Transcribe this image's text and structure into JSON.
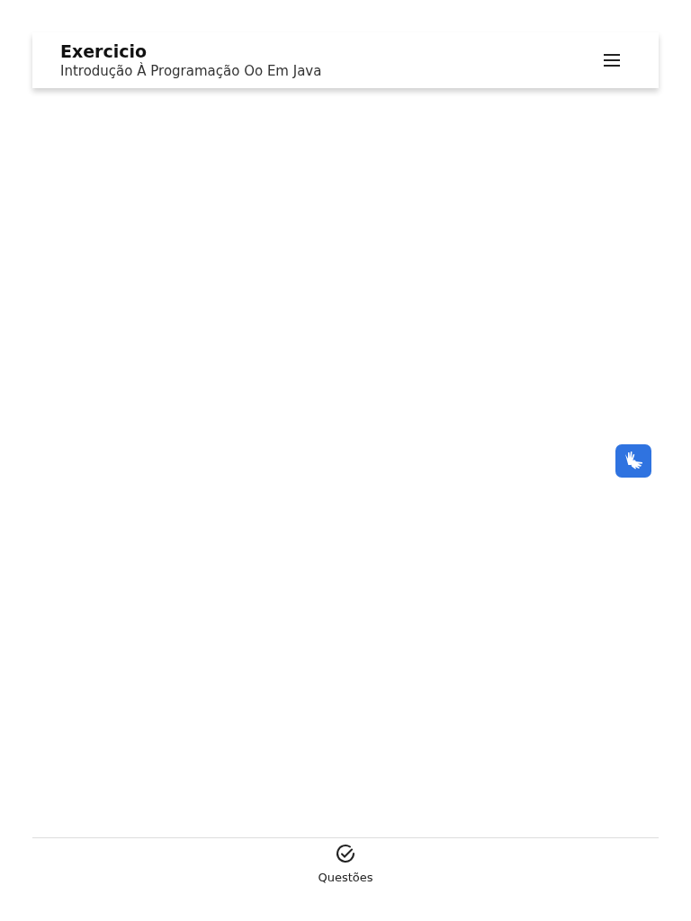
{
  "header": {
    "title": "Exercicio",
    "subtitle": "Introdução À Programação Oo Em Java"
  },
  "bottom_nav": [
    {
      "label": "Questões",
      "selected": true
    }
  ]
}
